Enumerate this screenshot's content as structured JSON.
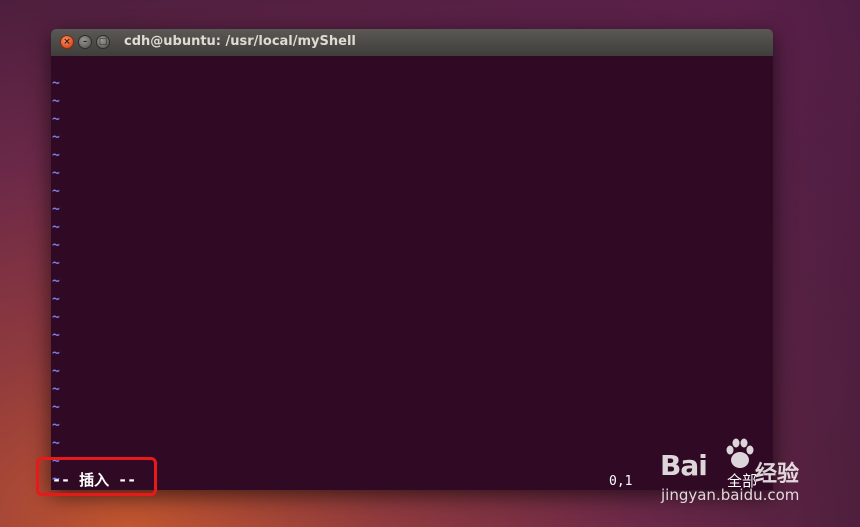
{
  "window": {
    "title": "cdh@ubuntu: /usr/local/myShell",
    "close_glyph": "×",
    "minimize_glyph": "–",
    "maximize_glyph": "□"
  },
  "editor": {
    "tilde_lines": [
      "~",
      "~",
      "~",
      "~",
      "~",
      "~",
      "~",
      "~",
      "~",
      "~",
      "~",
      "~",
      "~",
      "~",
      "~",
      "~",
      "~",
      "~",
      "~",
      "~",
      "~",
      "~",
      "~"
    ],
    "status_mode": "-- 插入 --",
    "cursor_position": "0,1",
    "scroll_position": "全部"
  },
  "watermark": {
    "brand": "Bai",
    "brand_suffix": "经验",
    "url": "jingyan.baidu.com",
    "icon": "paw-icon"
  },
  "colors": {
    "terminal_bg": "#300a24",
    "tilde": "#7e7fe6",
    "highlight_border": "#e8191b",
    "close_button": "#e2582b"
  }
}
